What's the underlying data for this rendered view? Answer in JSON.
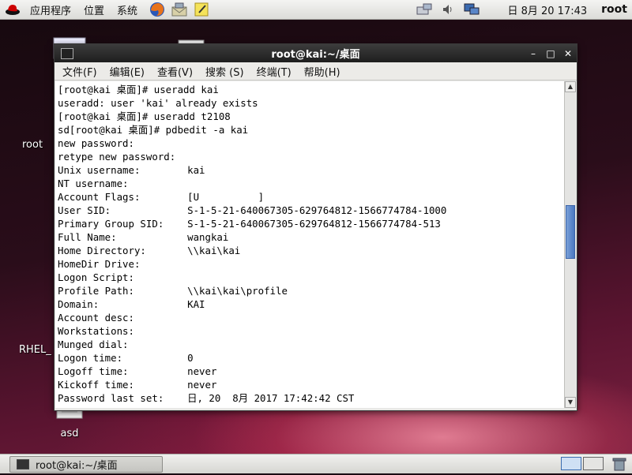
{
  "top_panel": {
    "applications": "应用程序",
    "places": "位置",
    "system": "系统",
    "clock": "日 8月 20 17:43",
    "user": "root"
  },
  "desktop_icons": {
    "computer_label": "root",
    "rhel_label": "RHEL_",
    "file_label": "asd"
  },
  "terminal": {
    "title": "root@kai:~/桌面",
    "menu": [
      "文件(F)",
      "编辑(E)",
      "查看(V)",
      "搜索 (S)",
      "终端(T)",
      "帮助(H)"
    ],
    "output": "[root@kai 桌面]# useradd kai\nuseradd: user 'kai' already exists\n[root@kai 桌面]# useradd t2108\nsd[root@kai 桌面]# pdbedit -a kai\nnew password:\nretype new password:\nUnix username:        kai\nNT username:\nAccount Flags:        [U          ]\nUser SID:             S-1-5-21-640067305-629764812-1566774784-1000\nPrimary Group SID:    S-1-5-21-640067305-629764812-1566774784-513\nFull Name:            wangkai\nHome Directory:       \\\\kai\\kai\nHomeDir Drive:\nLogon Script:\nProfile Path:         \\\\kai\\kai\\profile\nDomain:               KAI\nAccount desc:\nWorkstations:\nMunged dial:\nLogon time:           0\nLogoff time:          never\nKickoff time:         never\nPassword last set:    日, 20  8月 2017 17:42:42 CST",
    "window_controls": {
      "minimize": "–",
      "maximize": "□",
      "close": "✕"
    },
    "scroll_position": 0.45
  },
  "taskbar": {
    "task_label": "root@kai:~/桌面"
  }
}
